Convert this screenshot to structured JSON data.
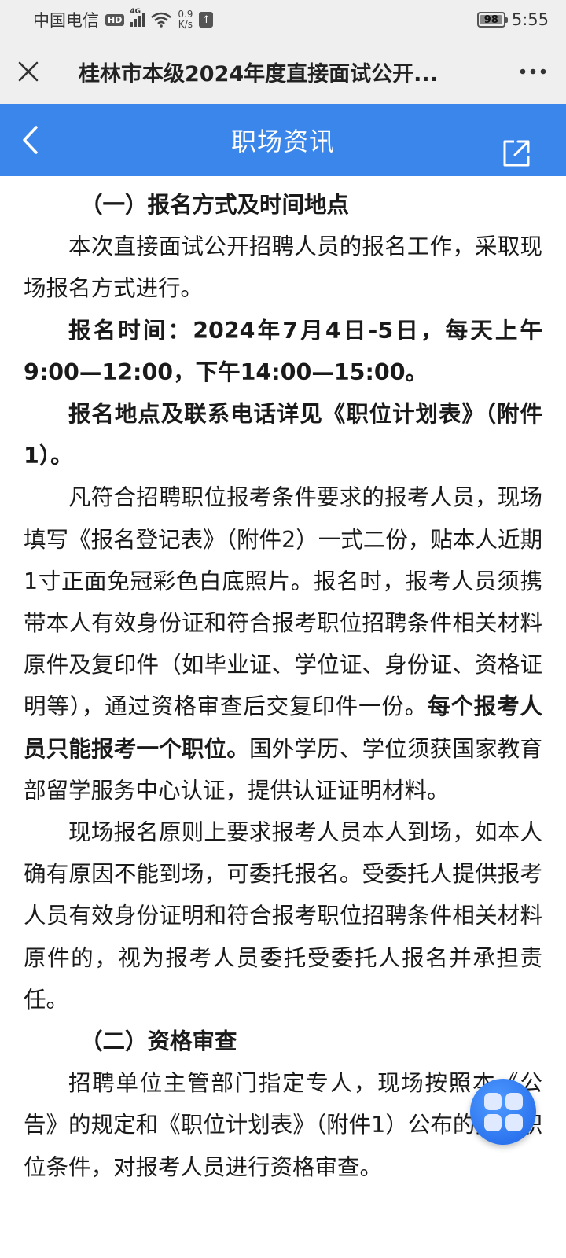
{
  "status_bar": {
    "carrier": "中国电信",
    "hd": "HD",
    "network": "4G",
    "speed_value": "0.9",
    "speed_unit": "K/s",
    "battery": "98",
    "battery_level": 0.98,
    "time": "5:55"
  },
  "titlebar": {
    "title": "桂林市本级2024年度直接面试公开..."
  },
  "header": {
    "title": "职场资讯"
  },
  "article": {
    "section1_heading": "（一）报名方式及时间地点",
    "p1": "本次直接面试公开招聘人员的报名工作，采取现场报名方式进行。",
    "p2": "报名时间：2024年7月4日-5日，每天上午9:00—12:00，下午14:00—15:00。",
    "p3": "报名地点及联系电话详见《职位计划表》（附件1）。",
    "p4_normal": "凡符合招聘职位报考条件要求的报考人员，现场填写《报名登记表》（附件2）一式二份，贴本人近期1寸正面免冠彩色白底照片。报名时，报考人员须携带本人有效身份证和符合报考职位招聘条件相关材料原件及复印件（如毕业证、学位证、身份证、资格证明等），通过资格审查后交复印件一份。",
    "p4_bold": "每个报考人员只能报考一个职位。",
    "p4_tail": "国外学历、学位须获国家教育部留学服务中心认证，提供认证证明材料。",
    "p5": "现场报名原则上要求报考人员本人到场，如本人确有原因不能到场，可委托报名。受委托人提供报考人员有效身份证明和符合报考职位招聘条件相关材料原件的，视为报考人员委托受委托人报名并承担责任。",
    "section2_heading": "（二）资格审查",
    "p6": "招聘单位主管部门指定专人，现场按照本《公告》的规定和《职位计划表》（附件1）公布的招聘职位条件，对报考人员进行资格审查。"
  },
  "colors": {
    "header_blue": "#3b86ea",
    "status_bg": "#efefef",
    "float_button": "#1d64e8"
  }
}
